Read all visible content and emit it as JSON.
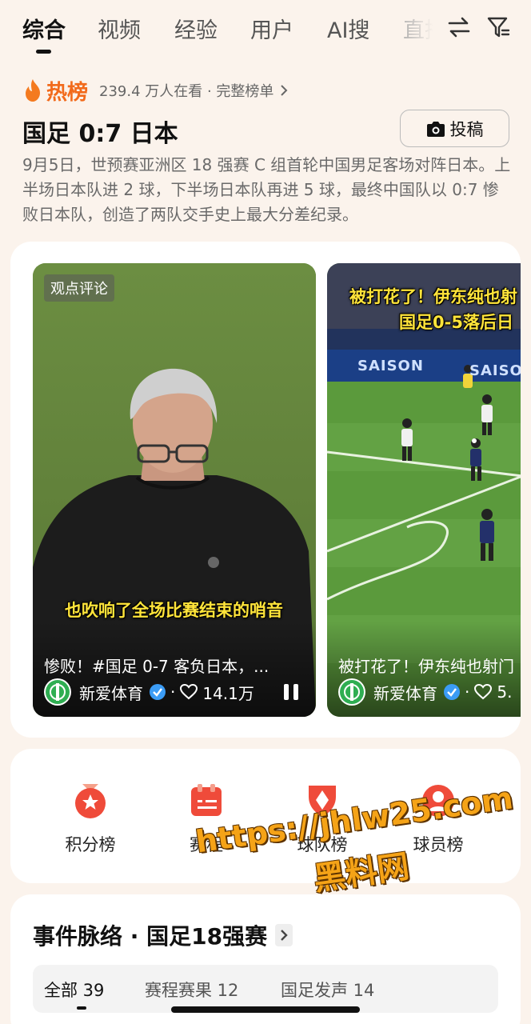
{
  "tabs": [
    {
      "label": "综合",
      "active": true
    },
    {
      "label": "视频"
    },
    {
      "label": "经验"
    },
    {
      "label": "用户"
    },
    {
      "label": "AI搜"
    },
    {
      "label": "直播"
    }
  ],
  "hot": {
    "label": "热榜",
    "meta": "239.4 万人在看 · 完整榜单"
  },
  "topic": {
    "title": "国足 0:7 日本",
    "post_button": "投稿",
    "description": "9月5日，世预赛亚洲区 18 强赛 C 组首轮中国男足客场对阵日本。上半场日本队进 2 球，下半场日本队再进 5 球，最终中国队以 0:7 惨败日本队，创造了两队交手史上最大分差纪录。"
  },
  "videos": [
    {
      "tag": "观点评论",
      "subtitle": "也吹响了全场比赛结束的哨音",
      "title": "惨败！#国足 0-7 客负日本，...",
      "author": "新爱体育",
      "likes": "14.1万"
    },
    {
      "overlay_line1": "被打花了！伊东纯也射",
      "overlay_line2": "国足0-5落后日",
      "board_text1": "SAISON",
      "board_text2": "SAISON",
      "title": "被打花了！伊东纯也射门",
      "author": "新爱体育",
      "likes": "5."
    }
  ],
  "ranks": [
    {
      "label": "积分榜",
      "icon": "medal-star-icon"
    },
    {
      "label": "赛程",
      "icon": "schedule-icon"
    },
    {
      "label": "球队榜",
      "icon": "team-badge-icon"
    },
    {
      "label": "球员榜",
      "icon": "player-icon"
    }
  ],
  "watermark": {
    "line1": "https://jhlw25.com",
    "line2": "黑料网"
  },
  "timeline": {
    "title": "事件脉络 · 国足18强赛",
    "filters": [
      {
        "label": "全部 39",
        "active": true
      },
      {
        "label": "赛程赛果 12"
      },
      {
        "label": "国足发声 14"
      }
    ]
  },
  "colors": {
    "accent": "#f26a1b",
    "background": "#fbf3ec",
    "subtitle_yellow": "#ffe43a"
  }
}
